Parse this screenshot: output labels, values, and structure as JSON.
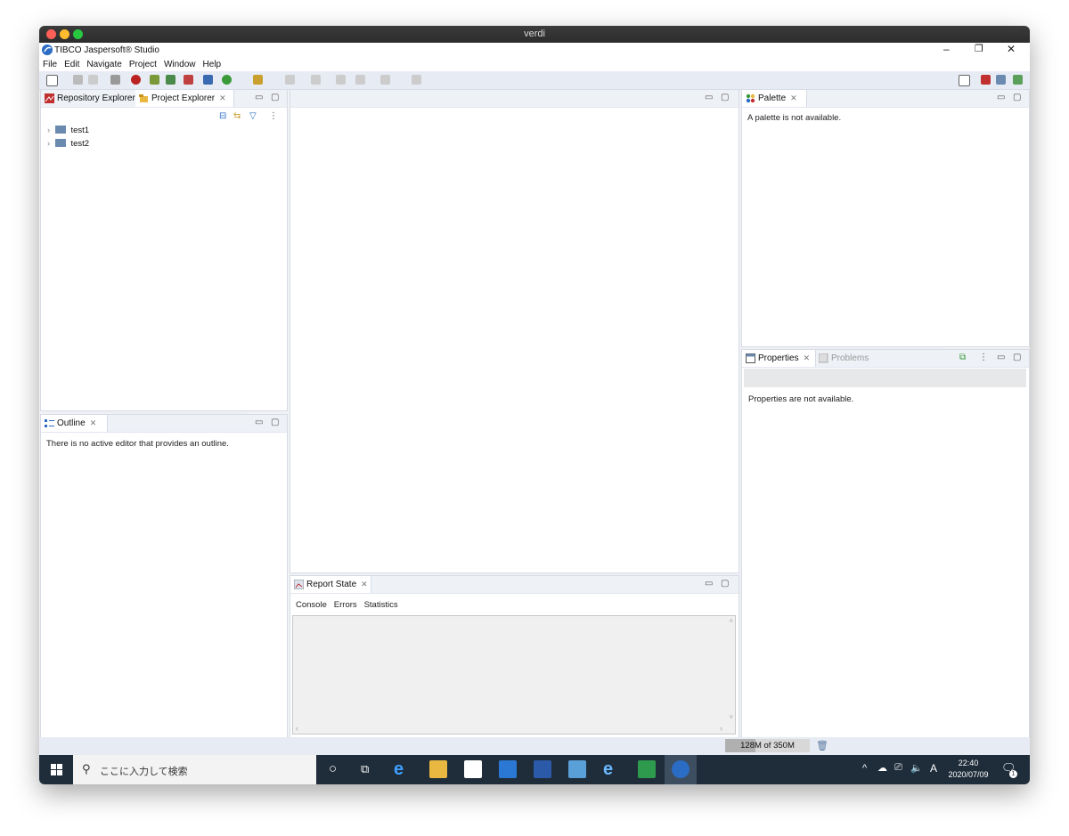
{
  "mac": {
    "title": "verdi"
  },
  "app": {
    "title": "TIBCO Jaspersoft® Studio",
    "minimize": "–",
    "restore": "❐",
    "close": "✕"
  },
  "menu": [
    "File",
    "Edit",
    "Navigate",
    "Project",
    "Window",
    "Help"
  ],
  "left_top": {
    "tabs": [
      {
        "label": "Repository Explorer"
      },
      {
        "label": "Project Explorer"
      }
    ],
    "tree": [
      {
        "label": "test1"
      },
      {
        "label": "test2"
      }
    ]
  },
  "outline": {
    "tab": "Outline",
    "message": "There is no active editor that provides an outline."
  },
  "palette": {
    "tab": "Palette",
    "message": "A palette is not available."
  },
  "properties": {
    "tab": "Properties",
    "tab2": "Problems",
    "message": "Properties are not available."
  },
  "report_state": {
    "tab": "Report State",
    "subtabs": [
      "Console",
      "Errors",
      "Statistics"
    ]
  },
  "status": {
    "memory": "128M of 350M"
  },
  "taskbar": {
    "search_placeholder": "ここに入力して検索",
    "time": "22:40",
    "date": "2020/07/09",
    "ime": "A",
    "notif_count": "1"
  },
  "colors": {
    "accent": "#2b6cc4",
    "toolbar": "#e7ebf3",
    "taskbar": "#1f2d3a"
  }
}
